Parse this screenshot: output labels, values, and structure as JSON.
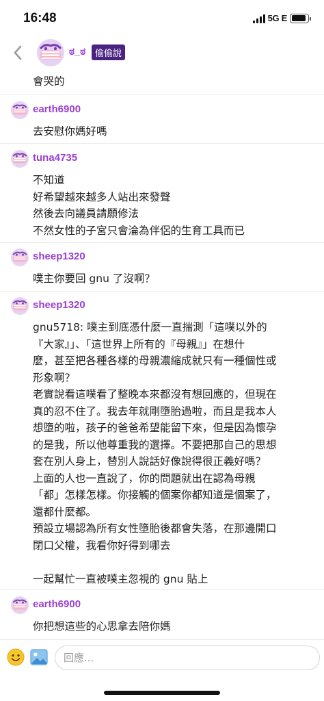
{
  "status_bar": {
    "time": "16:48",
    "network": "5G E",
    "battery_level": 0.9
  },
  "header": {
    "back_icon": "chevron-left-icon",
    "author_name": "ಠ_ಠ",
    "author_badge": "偷偷說"
  },
  "feed": {
    "cutoff_text": "會哭的",
    "replies": [
      {
        "username": "earth6900",
        "lines": [
          "去安慰你媽好嗎"
        ]
      },
      {
        "username": "tuna4735",
        "lines": [
          "不知道",
          "好希望越來越多人站出來發聲",
          "然後去向議員請願修法",
          "不然女性的子宮只會淪為伴侶的生育工具而已"
        ]
      },
      {
        "username": "sheep1320",
        "lines": [
          "噗主你要回 gnu 了沒啊？"
        ]
      },
      {
        "username": "sheep1320",
        "lines": [
          "gnu5718: 噗主到底憑什麼一直揣測「這噗以外的",
          "『大家』」、「這世界上所有的『母親』」在想什",
          "麼，甚至把各種各樣的母親濃縮成就只有一種個性或",
          "形象啊？",
          "老實說看這噗看了整晚本來都沒有想回應的，但現在",
          "真的忍不住了。我去年就剛墮胎過啦，而且是我本人",
          "想墮的啦，孩子的爸爸希望能留下來，但是因為懷孕",
          "的是我，所以他尊重我的選擇。不要把那自己的思想",
          "套在別人身上，替別人說話好像說得很正義好嗎？",
          "上面的人也一直說了，你的問題就出在認為母親",
          "「都」怎樣怎樣。你接觸的個案你都知道是個案了，",
          "還都什麼都。",
          "預設立場認為所有女性墮胎後都會失落，在那邊開口",
          "閉口父權，我看你好得到哪去",
          "",
          "一起幫忙一直被噗主忽視的 gnu 貼上"
        ]
      },
      {
        "username": "earth6900",
        "lines": [
          "你把想這些的心思拿去陪你媽"
        ]
      }
    ]
  },
  "composer": {
    "emoji_icon": "emoji-icon",
    "image_icon": "image-icon",
    "placeholder": "回應..."
  }
}
